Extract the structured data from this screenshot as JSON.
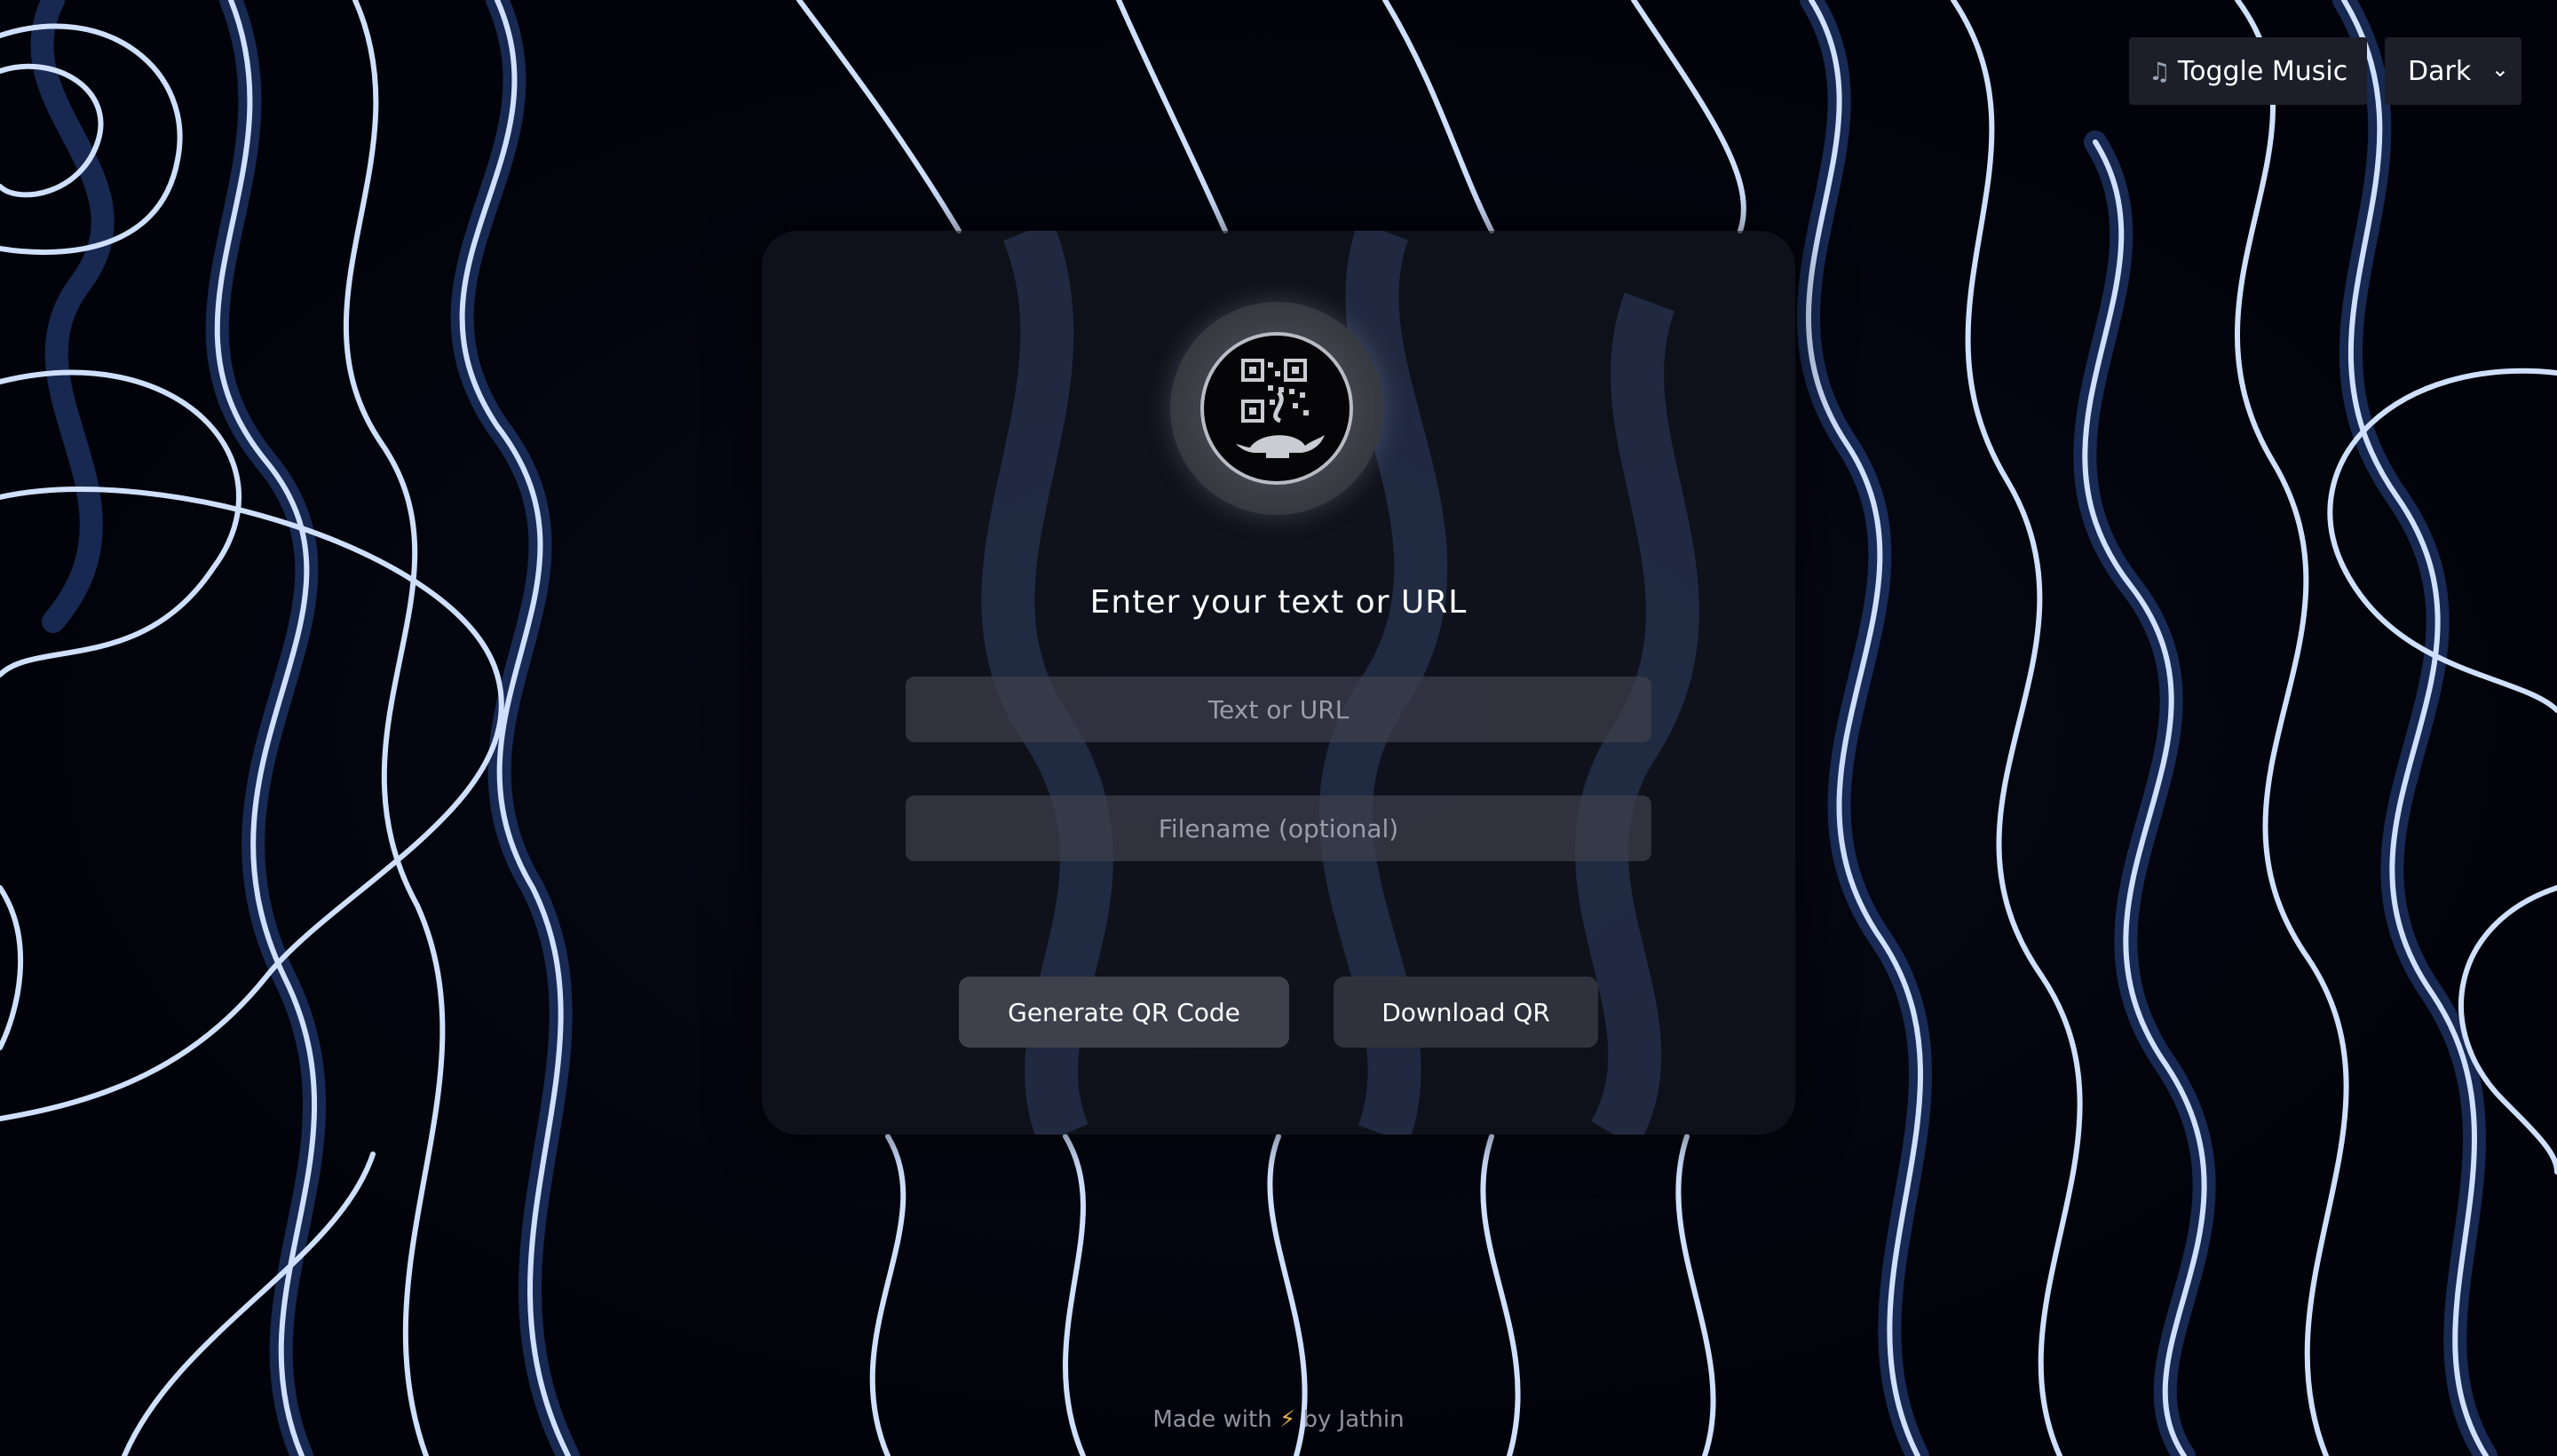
{
  "controls": {
    "music_icon": "♫",
    "toggle_music_label": "Toggle Music",
    "theme_value": "Dark"
  },
  "card": {
    "logo_icon": "qr-code-genie-lamp-icon",
    "heading": "Enter your text or URL",
    "text_placeholder": "Text or URL",
    "filename_placeholder": "Filename (optional)",
    "generate_label": "Generate QR Code",
    "download_label": "Download QR"
  },
  "footer": {
    "prefix": "Made with",
    "bolt": "⚡",
    "suffix": "by Jathin"
  },
  "colors": {
    "background": "#02030a",
    "wave_line": "#cfe0ff",
    "card": "#14161e",
    "button": "#3e414c"
  }
}
